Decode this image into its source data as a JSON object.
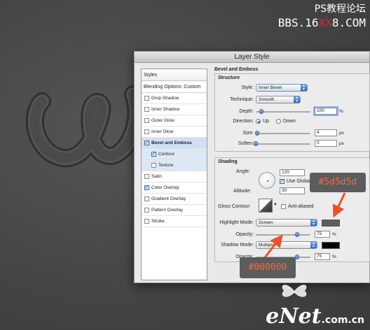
{
  "watermark": {
    "line1": "PS教程论坛",
    "line2_prefix": "BBS.16",
    "line2_red": "XX",
    "line2_suffix": "8.COM"
  },
  "dialog": {
    "title": "Layer Style",
    "styles_header": "Styles",
    "blending_options": "Blending Options: Custom",
    "style_items": [
      {
        "label": "Drop Shadow",
        "checked": false
      },
      {
        "label": "Inner Shadow",
        "checked": false
      },
      {
        "label": "Outer Glow",
        "checked": false
      },
      {
        "label": "Inner Glow",
        "checked": false
      },
      {
        "label": "Bevel and Emboss",
        "checked": true
      },
      {
        "label": "Contour",
        "checked": true
      },
      {
        "label": "Texture",
        "checked": false
      },
      {
        "label": "Satin",
        "checked": false
      },
      {
        "label": "Color Overlay",
        "checked": true
      },
      {
        "label": "Gradient Overlay",
        "checked": false
      },
      {
        "label": "Pattern Overlay",
        "checked": false
      },
      {
        "label": "Stroke",
        "checked": false
      }
    ],
    "bevel": {
      "section_title": "Bevel and Emboss",
      "structure_title": "Structure",
      "style_label": "Style:",
      "style_value": "Inner Bevel",
      "technique_label": "Technique:",
      "technique_value": "Smooth",
      "depth_label": "Depth:",
      "depth_value": "100",
      "depth_unit": "%",
      "depth_slider": 0.1,
      "direction_label": "Direction:",
      "direction_up": "Up",
      "direction_down": "Down",
      "size_label": "Size:",
      "size_value": "4",
      "size_unit": "px",
      "size_slider": 0.03,
      "soften_label": "Soften:",
      "soften_value": "0",
      "soften_unit": "px",
      "soften_slider": 0.0
    },
    "shading": {
      "title": "Shading",
      "angle_label": "Angle:",
      "angle_value": "120",
      "use_global_label": "Use Global",
      "altitude_label": "Altitude:",
      "altitude_value": "30",
      "gloss_contour_label": "Gloss Contour:",
      "anti_aliased_label": "Anti-aliased",
      "highlight_mode_label": "Highlight Mode:",
      "highlight_mode_value": "Screen",
      "highlight_color": "#5d5d5d",
      "highlight_opacity_label": "Opacity:",
      "highlight_opacity_value": "75",
      "highlight_opacity_unit": "%",
      "highlight_opacity_slider": 0.75,
      "shadow_mode_label": "Shadow Mode:",
      "shadow_mode_value": "Multiply",
      "shadow_color": "#000000",
      "shadow_opacity_label": "Opacity:",
      "shadow_opacity_value": "75",
      "shadow_opacity_unit": "%",
      "shadow_opacity_slider": 0.75
    }
  },
  "callouts": {
    "highlight": "#5d5d5d",
    "shadow": "#000000"
  },
  "logo": {
    "big": "eNet",
    "small": ".com.cn"
  },
  "colors": {
    "accent_arrow": "#e8542a",
    "selection": "#cfe0f5"
  }
}
